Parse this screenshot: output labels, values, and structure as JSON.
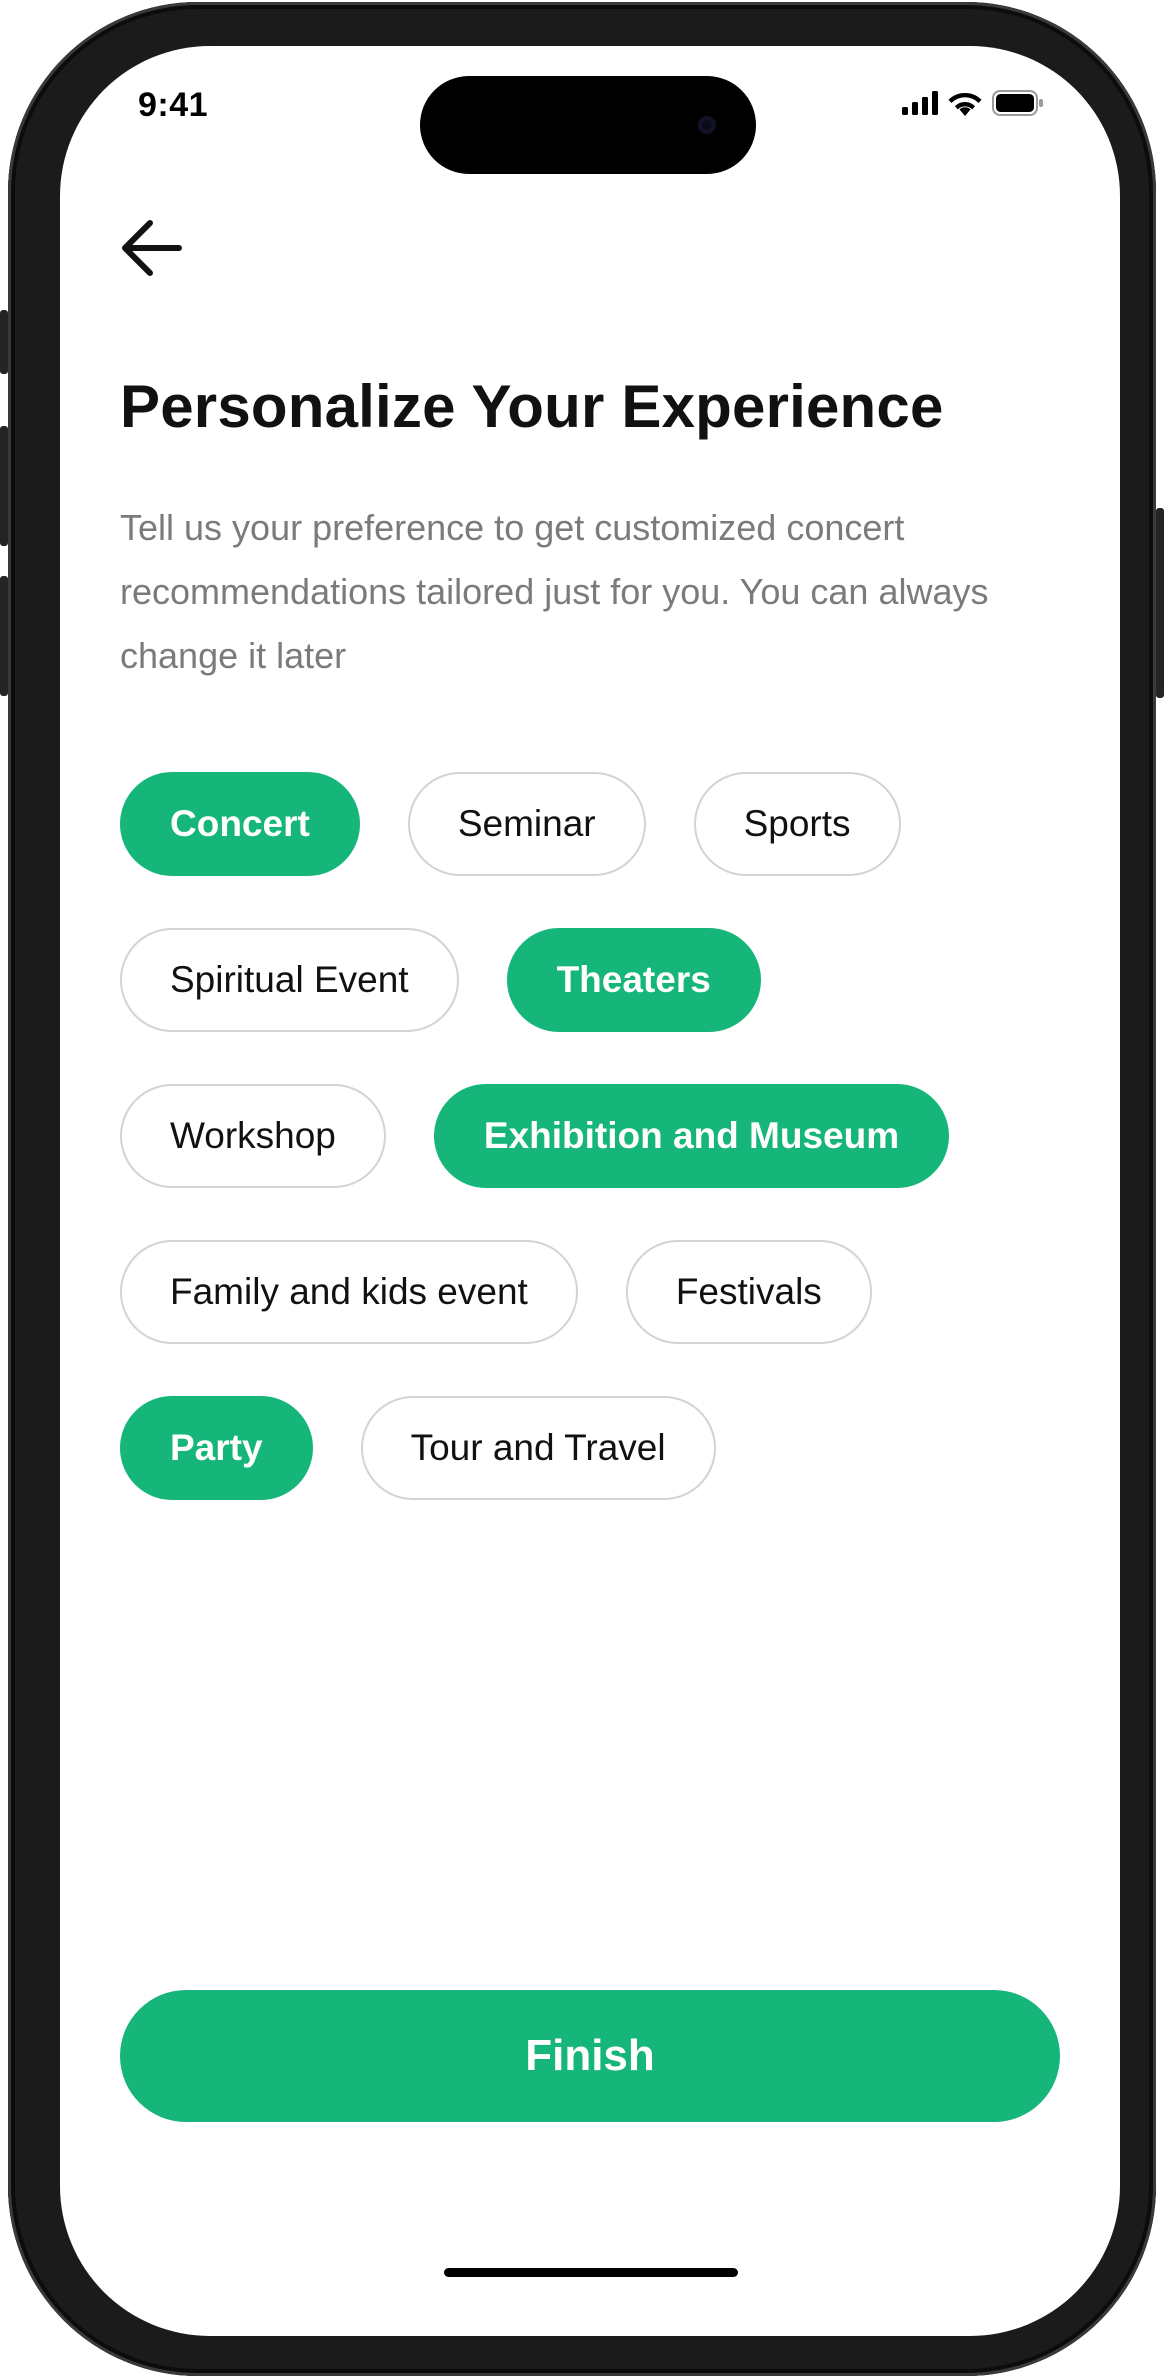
{
  "status_bar": {
    "time": "9:41",
    "icons": [
      "cellular-signal-icon",
      "wifi-icon",
      "battery-icon"
    ]
  },
  "header": {
    "back_icon": "arrow-left-icon"
  },
  "main": {
    "title": "Personalize Your Experience",
    "description": "Tell us your preference to get customized concert recommendations tailored just for you. You can always change it later"
  },
  "categories": [
    {
      "label": "Concert",
      "selected": true
    },
    {
      "label": "Seminar",
      "selected": false
    },
    {
      "label": "Sports",
      "selected": false
    },
    {
      "label": "Spiritual Event",
      "selected": false
    },
    {
      "label": "Theaters",
      "selected": true
    },
    {
      "label": "Workshop",
      "selected": false
    },
    {
      "label": "Exhibition and Museum",
      "selected": true
    },
    {
      "label": "Family and kids event",
      "selected": false
    },
    {
      "label": "Festivals",
      "selected": false
    },
    {
      "label": "Party",
      "selected": true
    },
    {
      "label": "Tour and Travel",
      "selected": false
    }
  ],
  "footer": {
    "finish_label": "Finish"
  },
  "colors": {
    "accent": "#16b67a",
    "chip_border": "#d3d3d3",
    "description_text": "#7b7b7b"
  }
}
